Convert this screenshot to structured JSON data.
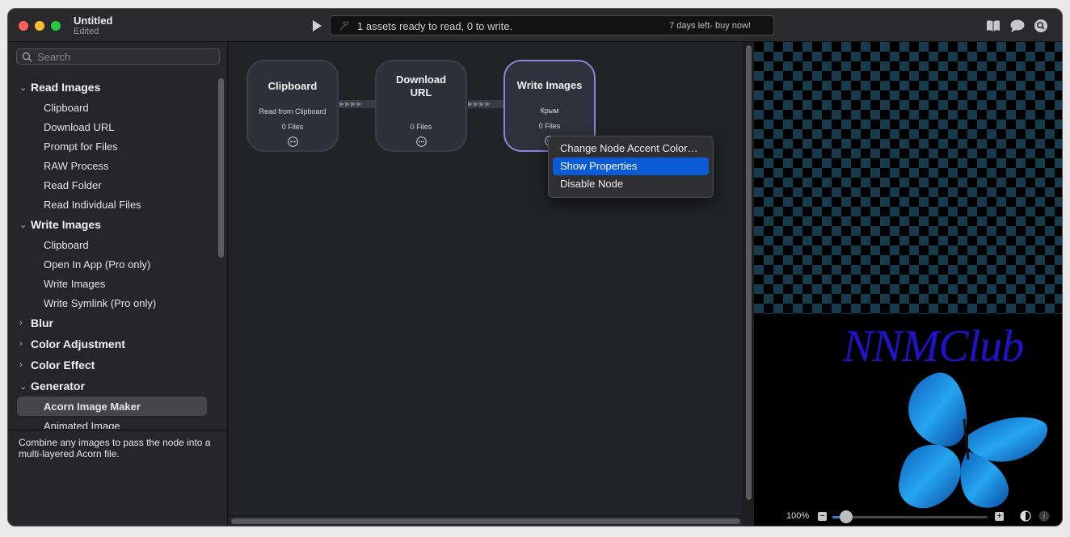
{
  "window": {
    "title": "Untitled",
    "subtitle": "Edited"
  },
  "toolbar": {
    "status": "1 assets ready to read, 0 to write.",
    "trial": "7 days left- buy now!",
    "icons": [
      "play-icon",
      "book-icon",
      "chat-bubble-icon",
      "search-icon"
    ]
  },
  "search": {
    "placeholder": "Search",
    "value": ""
  },
  "sidebar": {
    "categories": [
      {
        "label": "Read Images",
        "expanded": true,
        "items": [
          "Clipboard",
          "Download URL",
          "Prompt for Files",
          "RAW Process",
          "Read Folder",
          "Read Individual Files"
        ]
      },
      {
        "label": "Write Images",
        "expanded": true,
        "items": [
          "Clipboard",
          "Open In App (Pro only)",
          "Write Images",
          "Write Symlink (Pro only)"
        ]
      },
      {
        "label": "Blur",
        "expanded": false,
        "items": []
      },
      {
        "label": "Color Adjustment",
        "expanded": false,
        "items": []
      },
      {
        "label": "Color Effect",
        "expanded": false,
        "items": []
      },
      {
        "label": "Generator",
        "expanded": true,
        "items": [
          "Acorn Image Maker",
          "Animated Image"
        ]
      }
    ],
    "selected_item": "Acorn Image Maker",
    "description": "Combine any images to pass the node into a multi-layered Acorn file."
  },
  "nodes": [
    {
      "title": "Clipboard",
      "subtitle": "Read from Clipboard",
      "count": "0 Files"
    },
    {
      "title": "Download URL",
      "subtitle": "",
      "count": "0 Files"
    },
    {
      "title": "Write Images",
      "subtitle": "Крым",
      "count": "0 Files"
    }
  ],
  "connector_glyph": "▶▶▶▶",
  "context_menu": {
    "items": [
      "Change Node Accent Color…",
      "Show Properties",
      "Disable Node"
    ],
    "highlighted": "Show Properties"
  },
  "preview": {
    "watermark": "NNMClub",
    "zoom": "100%",
    "zoom_level": 0.07,
    "minus": "−",
    "plus": "+"
  },
  "colors": {
    "accent": "#0a5bd6",
    "node_active_border": "#8b87d6",
    "checker": "#173a4c",
    "watermark": "#1d14c9"
  }
}
